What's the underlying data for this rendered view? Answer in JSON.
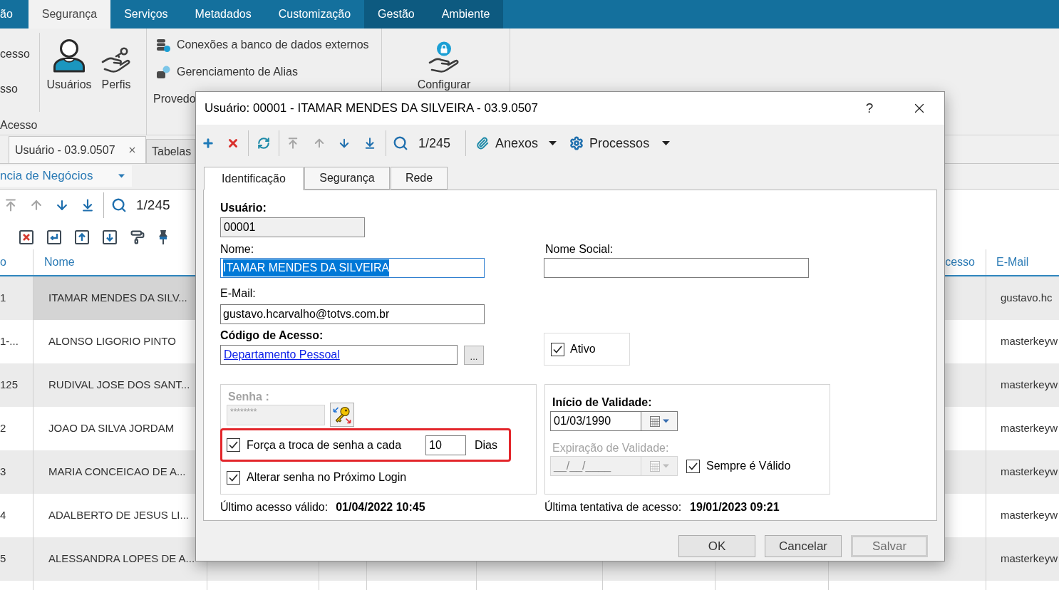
{
  "menu_tabs": [
    {
      "label": "ão",
      "selected": false,
      "kind": "standard"
    },
    {
      "label": "Segurança",
      "selected": true,
      "kind": "standard"
    },
    {
      "label": "Serviços",
      "selected": false,
      "kind": "standard"
    },
    {
      "label": "Metadados",
      "selected": false,
      "kind": "standard"
    },
    {
      "label": "Customização",
      "selected": false,
      "kind": "standard"
    },
    {
      "label": "Gestão",
      "selected": false,
      "kind": "contextual"
    },
    {
      "label": "Ambiente",
      "selected": false,
      "kind": "contextual"
    }
  ],
  "ribbon": {
    "access_group": {
      "items": [
        "cesso",
        "sso"
      ],
      "caption": "Acesso"
    },
    "user_group": {
      "buttons": [
        {
          "label": "Usuários",
          "kind": "user"
        },
        {
          "label": "Perfis",
          "kind": "profiles"
        }
      ]
    },
    "provider_group": {
      "items": [
        {
          "label": "Conexões a banco de dados externos",
          "kind": "database"
        },
        {
          "label": "Gerenciamento de Alias",
          "kind": "alias"
        },
        {
          "label": "Provedo",
          "kind": "plain"
        }
      ]
    },
    "configure_group": {
      "buttons": [
        {
          "label": "Configurar",
          "kind": "secure"
        }
      ]
    }
  },
  "document_tabs": [
    {
      "label": "Usuário - 03.9.0507",
      "selected": true,
      "closable": true
    },
    {
      "label": "Tabelas",
      "selected": false,
      "closable": false
    }
  ],
  "filter": {
    "value": "ncia de Negócios"
  },
  "list_toolbar": {
    "navigation": [
      {
        "disabled": true
      },
      {
        "disabled": true
      },
      {
        "disabled": false
      },
      {
        "disabled": false
      }
    ],
    "counter": "1/245"
  },
  "table": {
    "columns": {
      "column_1": "o",
      "nome": "Nome",
      "column_9": "cesso",
      "e_mail": "E-Mail"
    },
    "rows": [
      {
        "column_1": "1",
        "nome": "ITAMAR MENDES DA SILV...",
        "e_mail": "gustavo.hc",
        "selected": true
      },
      {
        "column_1": "1-...",
        "nome": "ALONSO LIGORIO PINTO",
        "e_mail": "masterkeyw",
        "selected": false
      },
      {
        "column_1": "125",
        "nome": "RUDIVAL JOSE DOS SANT...",
        "e_mail": "masterkeyw",
        "selected": false
      },
      {
        "column_1": "2",
        "nome": "JOAO DA SILVA JORDAM",
        "e_mail": "masterkeyw",
        "selected": false
      },
      {
        "column_1": "3",
        "nome": "MARIA CONCEICAO DE A...",
        "e_mail": "masterkeyw",
        "selected": false
      },
      {
        "column_1": "4",
        "nome": "ADALBERTO DE JESUS LI...",
        "e_mail": "masterkeyw",
        "selected": false
      },
      {
        "column_1": "5",
        "nome": "ALESSANDRA LOPES DE A...",
        "e_mail": "masterkeyw",
        "selected": false
      }
    ]
  },
  "dialog": {
    "title": "Usuário: 00001 - ITAMAR MENDES DA SILVEIRA - 03.9.0507",
    "help": "?",
    "toolbar": {
      "navigation": [
        {
          "disabled": true
        },
        {
          "disabled": true
        },
        {
          "disabled": false
        },
        {
          "disabled": false
        }
      ],
      "counter": "1/245",
      "menus": [
        {
          "label": "Anexos",
          "kind": "attachments"
        },
        {
          "label": "Processos",
          "kind": "processes"
        }
      ]
    },
    "tabs": [
      {
        "label": "Identificação",
        "selected": true
      },
      {
        "label": "Segurança",
        "selected": false
      },
      {
        "label": "Rede",
        "selected": false
      }
    ],
    "form": {
      "usuario": {
        "label": "Usuário:",
        "value": "00001",
        "required": true
      },
      "nome": {
        "label": "Nome:",
        "value": "ITAMAR MENDES DA SILVEIRA",
        "required": false,
        "selected": true
      },
      "nome_social": {
        "label": "Nome Social:",
        "required": false
      },
      "email": {
        "label": "E-Mail:",
        "value": "gustavo.hcarvalho@totvs.com.br",
        "required": false
      },
      "codigo_acesso": {
        "label": "Código de Acesso:",
        "value": "Departamento Pessoal",
        "required": true,
        "lookup_button": "..."
      },
      "ativo": {
        "label": "Ativo",
        "checked": true
      },
      "senha": {
        "label": "Senha :",
        "value": "********",
        "required": true,
        "disabled": true
      },
      "forca_troca": {
        "label": "Força a troca de senha a cada",
        "value": "10",
        "unit": "Dias",
        "checked": true,
        "highlighted": true
      },
      "alterar_proximo_login": {
        "label": "Alterar senha no Próximo Login",
        "checked": true
      },
      "inicio_validade": {
        "label": "Início de Validade:",
        "value": "01/03/1990",
        "required": true,
        "disabled": false
      },
      "expiracao_validade": {
        "label": "Expiração de Validade:",
        "placeholder": "__/__/____",
        "required": false,
        "disabled": true
      },
      "sempre_valido": {
        "label": "Sempre é Válido",
        "checked": true
      },
      "ultimo_acesso": {
        "label": "Último acesso válido:",
        "value": "01/04/2022 10:45"
      },
      "ultima_tentativa": {
        "label": "Última tentativa de acesso:",
        "value": "19/01/2023 09:21"
      }
    },
    "buttons": [
      {
        "label": "OK",
        "disabled": false
      },
      {
        "label": "Cancelar",
        "disabled": false
      },
      {
        "label": "Salvar",
        "disabled": true
      }
    ]
  }
}
